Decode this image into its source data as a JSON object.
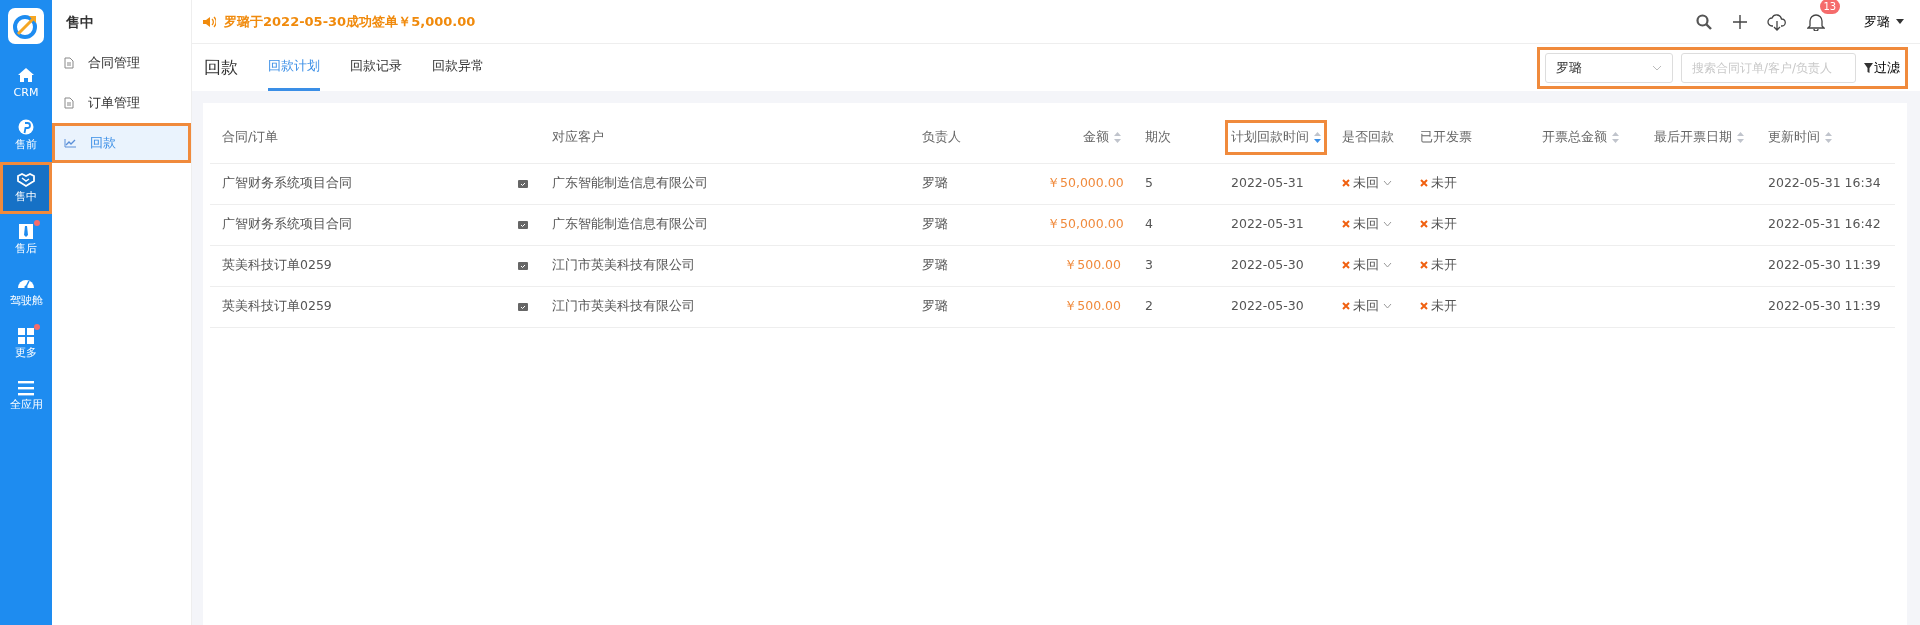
{
  "rail": {
    "items": [
      {
        "label": "CRM",
        "selected": false,
        "badge_dot": false,
        "highlighted": false
      },
      {
        "label": "售前",
        "selected": false,
        "badge_dot": false,
        "highlighted": false
      },
      {
        "label": "售中",
        "selected": true,
        "badge_dot": false,
        "highlighted": true
      },
      {
        "label": "售后",
        "selected": false,
        "badge_dot": true,
        "highlighted": false
      },
      {
        "label": "驾驶舱",
        "selected": false,
        "badge_dot": false,
        "highlighted": false
      },
      {
        "label": "更多",
        "selected": false,
        "badge_dot": true,
        "highlighted": false
      },
      {
        "label": "全应用",
        "selected": false,
        "badge_dot": false,
        "highlighted": false
      }
    ]
  },
  "sidebar": {
    "title": "售中",
    "items": [
      {
        "label": "合同管理",
        "selected": false,
        "highlighted": false
      },
      {
        "label": "订单管理",
        "selected": false,
        "highlighted": false
      },
      {
        "label": "回款",
        "selected": true,
        "highlighted": true
      }
    ]
  },
  "notice": "罗璐于2022-05-30成功签单￥5,000.00",
  "header": {
    "notification_count": "13",
    "user": "罗璐"
  },
  "page": {
    "title": "回款",
    "tabs": [
      {
        "label": "回款计划",
        "selected": true
      },
      {
        "label": "回款记录",
        "selected": false
      },
      {
        "label": "回款异常",
        "selected": false
      }
    ]
  },
  "filters": {
    "highlighted": true,
    "owner": "罗璐",
    "search": {
      "placeholder": "搜索合同订单/客户/负责人"
    },
    "filter_button": "过滤"
  },
  "table": {
    "columns": [
      {
        "label": "合同/订单",
        "highlighted": false
      },
      {
        "label": "对应客户",
        "highlighted": false
      },
      {
        "label": "负责人",
        "highlighted": false
      },
      {
        "label": "金额",
        "sorted": false,
        "highlighted": false
      },
      {
        "label": "期次",
        "highlighted": false
      },
      {
        "label": "计划回款时间",
        "sorted": true,
        "highlighted": true
      },
      {
        "label": "是否回款",
        "highlighted": false
      },
      {
        "label": "已开发票",
        "highlighted": false
      },
      {
        "label": "开票总金额",
        "sorted": false,
        "highlighted": false
      },
      {
        "label": "最后开票日期",
        "sorted": false,
        "highlighted": false
      },
      {
        "label": "更新时间",
        "sorted": false,
        "highlighted": false
      }
    ],
    "rows": [
      {
        "contract": "广智财务系统项目合同",
        "customer": "广东智能制造信息有限公司",
        "owner": "罗璐",
        "amount": "￥50,000.00",
        "installment": "5",
        "plan_date": "2022-05-31",
        "paid": "未回",
        "invoiced": "未开",
        "updated": "2022-05-31 16:34"
      },
      {
        "contract": "广智财务系统项目合同",
        "customer": "广东智能制造信息有限公司",
        "owner": "罗璐",
        "amount": "￥50,000.00",
        "installment": "4",
        "plan_date": "2022-05-31",
        "paid": "未回",
        "invoiced": "未开",
        "updated": "2022-05-31 16:42"
      },
      {
        "contract": "英美科技订单0259",
        "customer": "江门市英美科技有限公司",
        "owner": "罗璐",
        "amount": "￥500.00",
        "installment": "3",
        "plan_date": "2022-05-30",
        "paid": "未回",
        "invoiced": "未开",
        "updated": "2022-05-30 11:39"
      },
      {
        "contract": "英美科技订单0259",
        "customer": "江门市英美科技有限公司",
        "owner": "罗璐",
        "amount": "￥500.00",
        "installment": "2",
        "plan_date": "2022-05-30",
        "paid": "未回",
        "invoiced": "未开",
        "updated": "2022-05-30 11:39"
      }
    ]
  }
}
